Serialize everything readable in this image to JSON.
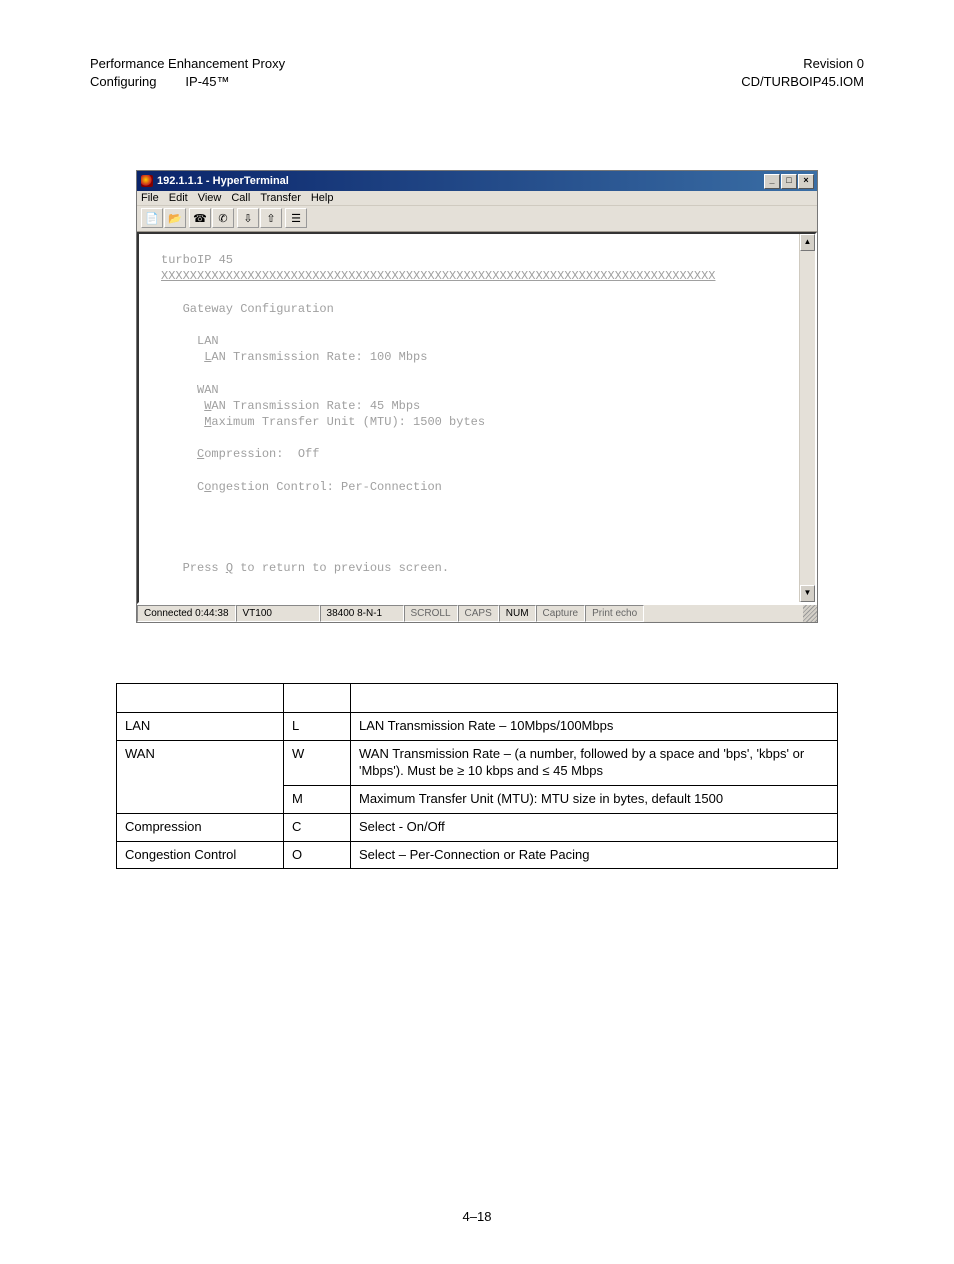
{
  "page_header": {
    "left_line1": "Performance Enhancement Proxy",
    "left_line2": "Configuring",
    "left_line2_indent": "IP-45™",
    "right_line1": "Revision 0",
    "right_line2": "CD/TURBOIP45.IOM"
  },
  "window": {
    "title": "192.1.1.1 - HyperTerminal",
    "controls": {
      "min": "_",
      "max": "□",
      "close": "×"
    },
    "menu": [
      "File",
      "Edit",
      "View",
      "Call",
      "Transfer",
      "Help"
    ],
    "toolbar_icons": [
      "new-doc-icon",
      "open-folder-icon",
      "connect-icon",
      "disconnect-icon",
      "send-icon",
      "receive-icon",
      "properties-icon"
    ]
  },
  "terminal": {
    "app_title": "turboIP 45",
    "sep": "XXXXXXXXXXXXXXXXXXXXXXXXXXXXXXXXXXXXXXXXXXXXXXXXXXXXXXXXXXXXXXXXXXXXXXXXXXXXX",
    "section_hdr": "   Gateway Configuration",
    "lan_hdr": "     LAN",
    "lan_l": "      ",
    "lan_u": "L",
    "lan_rest": "AN Transmission Rate: 100 Mbps",
    "wan_hdr": "     WAN",
    "wan_l": "      ",
    "wan_u": "W",
    "wan_rest": "AN Transmission Rate: 45 Mbps",
    "mtu_l": "      ",
    "mtu_u": "M",
    "mtu_rest": "aximum Transfer Unit (MTU): 1500 bytes",
    "comp_l": "     ",
    "comp_u": "C",
    "comp_rest": "ompression:  Off",
    "cong_l": "     C",
    "cong_u": "o",
    "cong_rest": "ngestion Control: Per-Connection",
    "quit_l": "   Press ",
    "quit_u": "Q",
    "quit_rest": " to return to previous screen."
  },
  "statusbar": {
    "connected": "Connected 0:44:38",
    "emulation": "VT100",
    "port": "38400 8-N-1",
    "items": [
      "SCROLL",
      "CAPS",
      "NUM",
      "Capture",
      "Print echo"
    ],
    "active": "NUM"
  },
  "table": {
    "headers": [
      "",
      "",
      ""
    ],
    "rows": [
      {
        "c1": "LAN",
        "c2": "L",
        "c3": "LAN Transmission Rate – 10Mbps/100Mbps",
        "rs1": 1
      },
      {
        "c1": "WAN",
        "c2": "W",
        "c3": "WAN Transmission Rate – (a number, followed by a space and 'bps', 'kbps' or 'Mbps'). Must be ≥ 10 kbps and ≤ 45 Mbps",
        "rs1": 2
      },
      {
        "c1": null,
        "c2": "M",
        "c3": "Maximum Transfer Unit (MTU): MTU size in bytes, default 1500",
        "rs1": 0
      },
      {
        "c1": "Compression",
        "c2": "C",
        "c3": "Select - On/Off",
        "rs1": 1
      },
      {
        "c1": "Congestion Control",
        "c2": "O",
        "c3": "Select – Per-Connection or Rate Pacing",
        "rs1": 1
      }
    ]
  },
  "page_number": "4–18"
}
